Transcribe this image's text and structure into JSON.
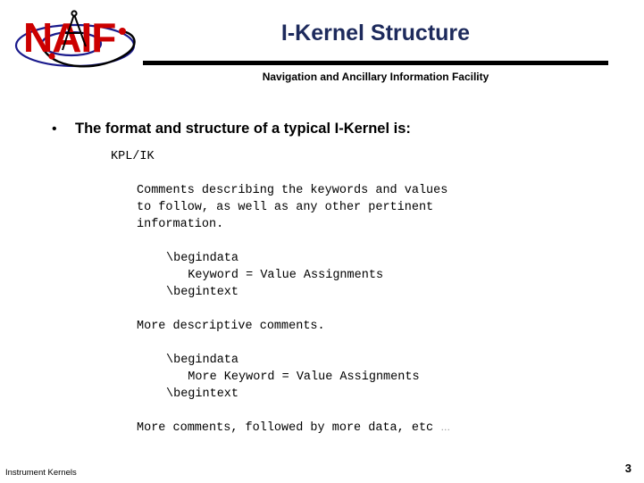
{
  "header": {
    "title": "I-Kernel Structure",
    "organization": "Navigation and Ancillary Information Facility",
    "logo": {
      "wordmark": "NAIF",
      "wordmark_color": "#cc0000",
      "orbit_color": "#1a1a8c",
      "arc_color": "#000000",
      "dot_color": "#cc0000",
      "compass_color": "#000000"
    },
    "rule_color": "#000000",
    "title_color": "#1d2a5c"
  },
  "body": {
    "bullet_mark": "•",
    "bullet_text": "The format and structure of a typical I-Kernel is:",
    "listing": [
      {
        "indent": 0,
        "text": "KPL/IK"
      },
      {
        "indent": -1,
        "text": ""
      },
      {
        "indent": 1,
        "text": "Comments describing the keywords and values"
      },
      {
        "indent": 1,
        "text": "to follow, as well as any other pertinent"
      },
      {
        "indent": 1,
        "text": "information."
      },
      {
        "indent": -1,
        "text": ""
      },
      {
        "indent": 2,
        "text": "\\begindata"
      },
      {
        "indent": 2,
        "text": "   Keyword = Value Assignments"
      },
      {
        "indent": 2,
        "text": "\\begintext"
      },
      {
        "indent": -1,
        "text": ""
      },
      {
        "indent": 1,
        "text": "More descriptive comments."
      },
      {
        "indent": -1,
        "text": ""
      },
      {
        "indent": 2,
        "text": "\\begindata"
      },
      {
        "indent": 2,
        "text": "   More Keyword = Value Assignments"
      },
      {
        "indent": 2,
        "text": "\\begintext"
      },
      {
        "indent": -1,
        "text": ""
      },
      {
        "indent": 1,
        "text": "More comments, followed by more data, etc "
      }
    ],
    "trailing_ellipsis": "…"
  },
  "footer": {
    "label": "Instrument Kernels",
    "page_number": "3"
  }
}
